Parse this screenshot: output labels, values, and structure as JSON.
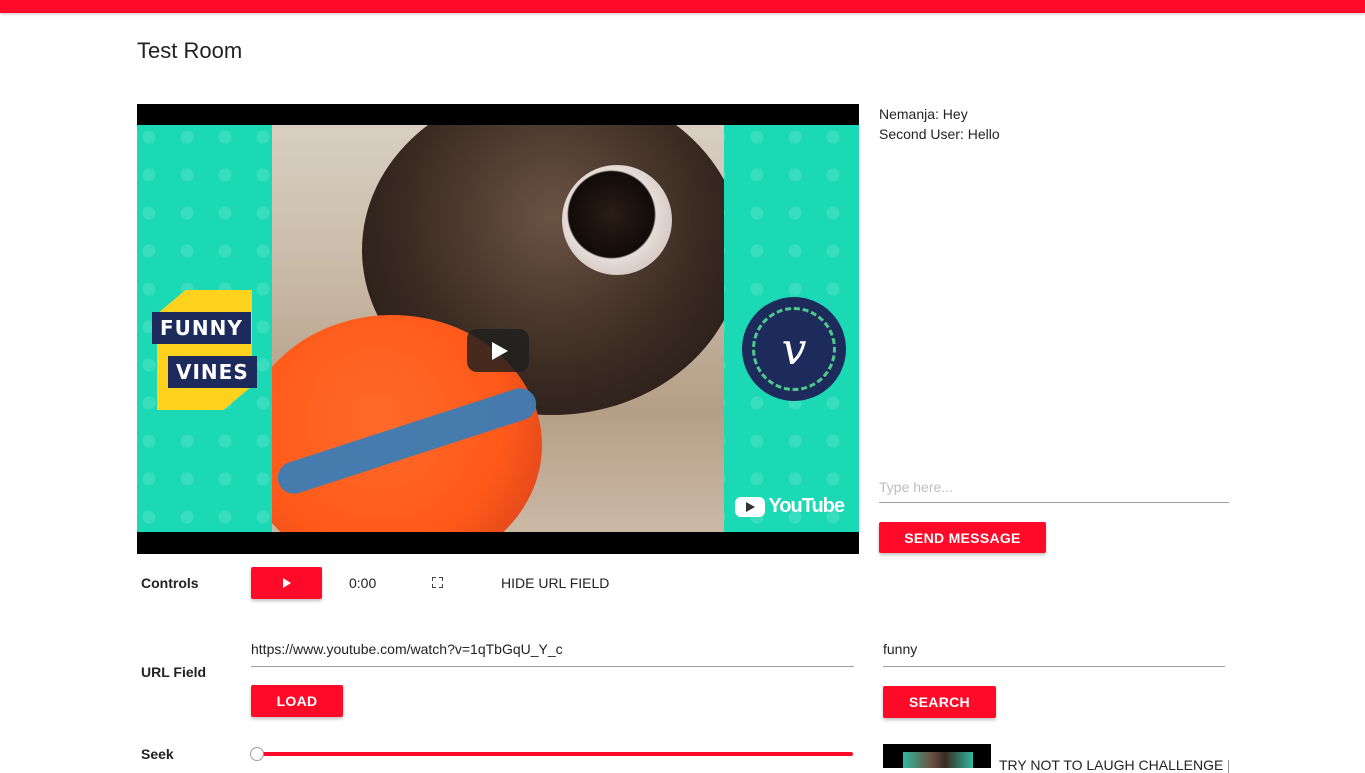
{
  "room": {
    "title": "Test Room"
  },
  "colors": {
    "accent": "#ff0a28"
  },
  "video": {
    "thumbnail_badge_left": [
      "FUNNY",
      "VINES"
    ],
    "thumbnail_badge_right": "v",
    "watermark": "YouTube"
  },
  "chat": {
    "messages": [
      {
        "text": "Nemanja: Hey"
      },
      {
        "text": "Second User: Hello"
      }
    ],
    "input_placeholder": "Type here...",
    "send_label": "SEND MESSAGE"
  },
  "controls": {
    "label": "Controls",
    "time": "0:00",
    "hide_url_label": "HIDE URL FIELD",
    "play_icon": "play-icon",
    "fullscreen_icon": "fullscreen-icon"
  },
  "url_field": {
    "label": "URL Field",
    "value": "https://www.youtube.com/watch?v=1qTbGqU_Y_c",
    "load_label": "LOAD"
  },
  "search": {
    "value": "funny",
    "button_label": "SEARCH",
    "results": [
      {
        "title": "TRY NOT TO LAUGH CHALLENGE |"
      }
    ]
  },
  "seek": {
    "label": "Seek",
    "progress": 0
  }
}
